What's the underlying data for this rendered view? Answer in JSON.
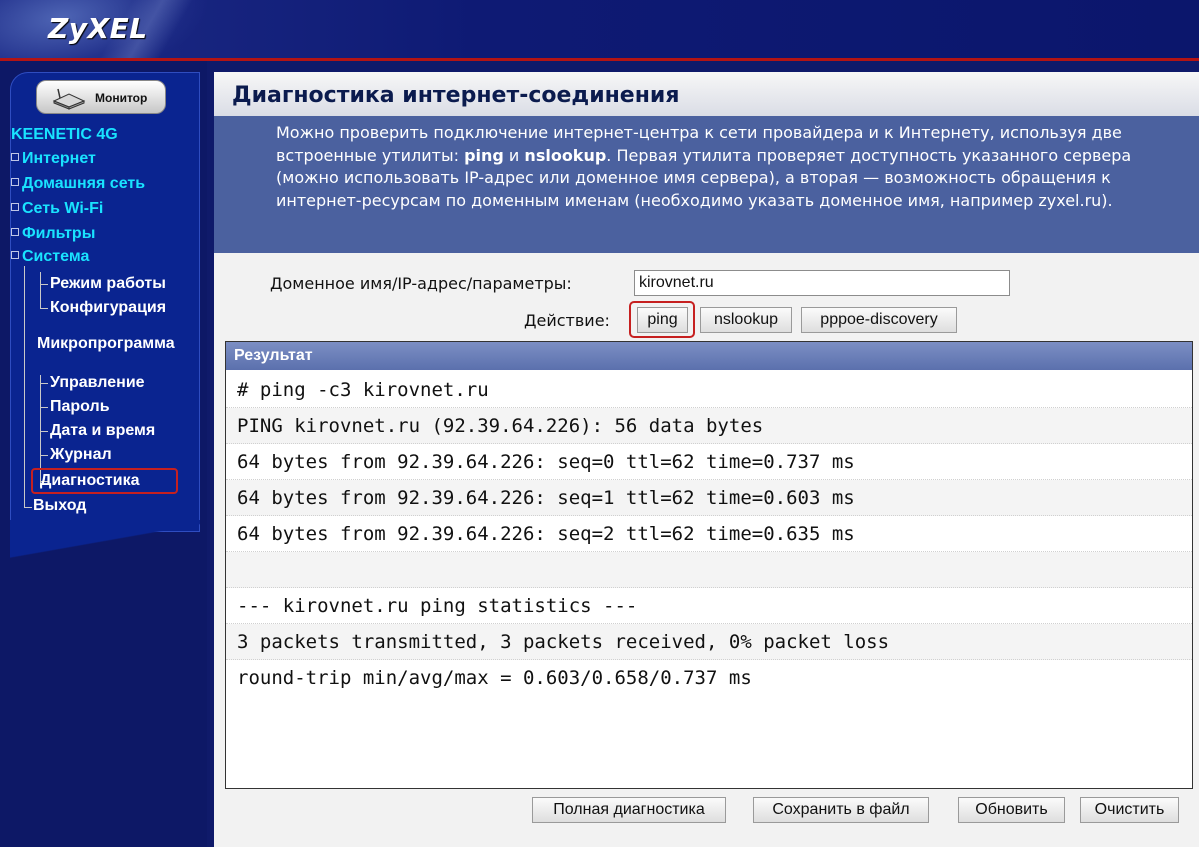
{
  "header": {
    "logo": "ZyXEL"
  },
  "sidebar": {
    "monitor_label": "Монитор",
    "device_name": "KEENETIC 4G",
    "items": [
      {
        "label": "Интернет"
      },
      {
        "label": "Домашняя сеть"
      },
      {
        "label": "Сеть Wi-Fi"
      },
      {
        "label": "Фильтры"
      },
      {
        "label": "Система"
      }
    ],
    "system_sub": [
      {
        "label": "Режим работы"
      },
      {
        "label": "Конфигурация"
      },
      {
        "label": "Микропрограмма"
      },
      {
        "label": "Управление"
      },
      {
        "label": "Пароль"
      },
      {
        "label": "Дата и время"
      },
      {
        "label": "Журнал"
      },
      {
        "label": "Диагностика"
      }
    ],
    "exit_label": "Выход"
  },
  "main": {
    "title": "Диагностика интернет-соединения",
    "description": {
      "part1": "Можно проверить подключение интернет-центра к сети провайдера и к Интернету, используя две встроенные утилиты: ",
      "ping": "ping",
      "and": " и ",
      "nslookup": "nslookup",
      "part2": ". Первая утилита проверяет доступность указанного сервера (можно использовать IP-адрес или доменное имя сервера), а вторая — возможность обращения к интернет-ресурсам по доменным именам (необходимо указать доменное имя, например zyxel.ru)."
    },
    "domain_label": "Доменное имя/IP-адрес/параметры:",
    "domain_value": "kirovnet.ru",
    "action_label": "Действие:",
    "actions": {
      "ping": "ping",
      "nslookup": "nslookup",
      "pppoe": "pppoe-discovery"
    },
    "result": {
      "header": "Результат",
      "lines": [
        "# ping -c3 kirovnet.ru",
        "PING kirovnet.ru (92.39.64.226): 56 data bytes",
        "64 bytes from 92.39.64.226: seq=0 ttl=62 time=0.737 ms",
        "64 bytes from 92.39.64.226: seq=1 ttl=62 time=0.603 ms",
        "64 bytes from 92.39.64.226: seq=2 ttl=62 time=0.635 ms",
        "",
        "--- kirovnet.ru ping statistics ---",
        "3 packets transmitted, 3 packets received, 0% packet loss",
        "round-trip min/avg/max = 0.603/0.658/0.737 ms"
      ]
    },
    "buttons": {
      "full_diag": "Полная диагностика",
      "save": "Сохранить в файл",
      "refresh": "Обновить",
      "clear": "Очистить"
    }
  },
  "colors": {
    "header_bg": "#0e1a74",
    "accent_red": "#b31414",
    "sidebar_panel": "#0a2490",
    "device_cyan": "#19e3ff",
    "desc_bg": "#4b619f",
    "result_header": "#6b7fbb"
  }
}
